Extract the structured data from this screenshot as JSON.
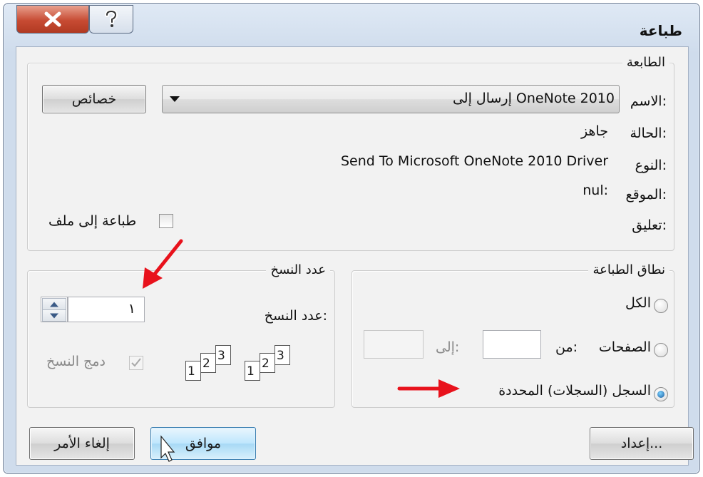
{
  "window": {
    "title": "طباعة",
    "close_icon": "close-icon",
    "help_icon": "help-icon"
  },
  "printer": {
    "legend": "الطابعة",
    "name_label": "الاسم:",
    "name_value": "إرسال إلى OneNote 2010",
    "properties_button": "خصائص",
    "status_label": "الحالة:",
    "status_value": "جاهز",
    "type_label": "النوع:",
    "type_value": "Send To Microsoft OneNote 2010 Driver",
    "where_label": "الموقع:",
    "where_value": "nul:",
    "comment_label": "تعليق:",
    "print_to_file_label": "طباعة إلى ملف",
    "print_to_file_checked": false
  },
  "range": {
    "legend": "نطاق الطباعة",
    "all_label": "الكل",
    "pages_label": "الصفحات",
    "from_label": "من:",
    "to_label": "إلى:",
    "from_value": "",
    "to_value": "",
    "selection_label": "السجل (السجلات) المحددة",
    "selected": "selection"
  },
  "copies": {
    "legend": "عدد النسخ",
    "count_label": "عدد النسخ:",
    "count_value": "١",
    "collate_label": "دمج النسخ",
    "collate_checked": true,
    "collate_pages": [
      "1",
      "2",
      "3",
      "1",
      "2",
      "3"
    ]
  },
  "buttons": {
    "setup": "إعداد...",
    "ok": "موافق",
    "cancel": "إلغاء الأمر"
  },
  "colors": {
    "annotation_arrow": "#e8121c",
    "close_button": "#c74b33",
    "default_button": "#a7d9f5"
  }
}
